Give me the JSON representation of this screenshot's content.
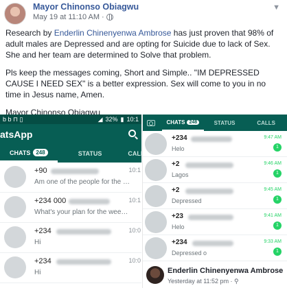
{
  "post": {
    "author": "Mayor Chinonso Obiagwu",
    "timestamp": "May 19 at 11:10 AM",
    "separator": "·",
    "paragraph1_before": "Research by ",
    "paragraph1_tag": "Enderlin Chinenyenwa Ambrose",
    "paragraph1_after": " has just proven that 98% of adult males are Depressed and are opting for Suicide due to lack of Sex. She and her team are determined to Solve that problem.",
    "paragraph2": "Pls keep the messages coming, Short and Simple.. \"IM DEPRESSED CAUSE I NEED SEX\" is a better expression. Sex will come to you in no time in Jesus name, Amen.",
    "signature": "Mayor Chinonso Obiagwu"
  },
  "left_phone": {
    "status_bar": {
      "left_icons": "b b ⊓ ▯",
      "battery": "32%",
      "time": "10:1"
    },
    "app_title": "atsApp",
    "tabs": [
      {
        "label": "CHATS",
        "badge": "248"
      },
      {
        "label": "STATUS"
      },
      {
        "label": "CALLS"
      }
    ],
    "chats": [
      {
        "name": "+90",
        "message": "Am one of the people for the sexual depres...",
        "time": "10:1"
      },
      {
        "name": "+234 000",
        "message": "What's your plan for the weekend",
        "time": "10:1"
      },
      {
        "name": "+234",
        "message": "Hi",
        "time": "10:0"
      },
      {
        "name": "+234",
        "message": "Hi",
        "time": "10:0"
      }
    ]
  },
  "right_phone": {
    "tabs": [
      {
        "label": "CHATS",
        "badge": "248"
      },
      {
        "label": "STATUS"
      },
      {
        "label": "CALLS"
      }
    ],
    "chats": [
      {
        "name": "+234",
        "message": "Helo",
        "time": "9:47 AM",
        "unread": "1"
      },
      {
        "name": "+2",
        "message": "Lagos",
        "time": "9:46 AM",
        "unread": "1"
      },
      {
        "name": "+2",
        "message": "Depressed",
        "time": "9:45 AM",
        "unread": "1"
      },
      {
        "name": "+23",
        "message": "Helo",
        "time": "9:41 AM",
        "unread": "1"
      },
      {
        "name": "+234",
        "message": "Depressed o",
        "time": "9:33 AM",
        "unread": "1"
      }
    ]
  },
  "comment": {
    "author": "Enderlin Chinenyenwa Ambrose",
    "meta": "Yesterday at 11:52 pm · ⚲"
  }
}
